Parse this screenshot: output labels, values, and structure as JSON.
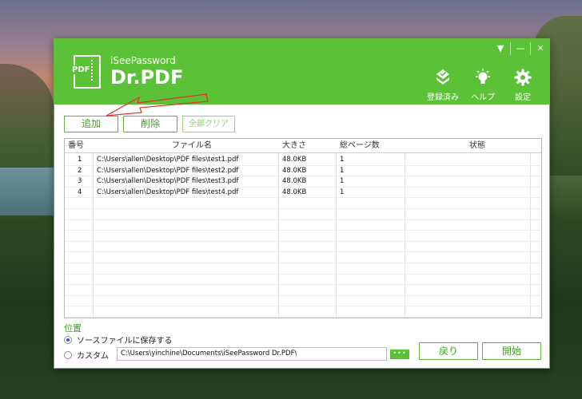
{
  "app": {
    "brand_small": "iSeePassword",
    "brand_big": "Dr.PDF",
    "logo_text": "PDF"
  },
  "window_controls": {
    "menu": "▼",
    "minimize": "—",
    "close": "✕"
  },
  "header_buttons": [
    {
      "label": "登録済み",
      "icon": "registered-icon"
    },
    {
      "label": "ヘルプ",
      "icon": "lightbulb-icon"
    },
    {
      "label": "設定",
      "icon": "gear-icon"
    }
  ],
  "toolbar": {
    "add": "追加",
    "delete": "削除",
    "clear_all": "全部クリア"
  },
  "table": {
    "headers": [
      "番号",
      "ファイル名",
      "大きさ",
      "総ページ数",
      "状態"
    ],
    "rows": [
      {
        "no": "1",
        "file": "C:\\Users\\allen\\Desktop\\PDF files\\test1.pdf",
        "size": "48.0KB",
        "pages": "1",
        "status": ""
      },
      {
        "no": "2",
        "file": "C:\\Users\\allen\\Desktop\\PDF files\\test2.pdf",
        "size": "48.0KB",
        "pages": "1",
        "status": ""
      },
      {
        "no": "3",
        "file": "C:\\Users\\allen\\Desktop\\PDF files\\test3.pdf",
        "size": "48.0KB",
        "pages": "1",
        "status": ""
      },
      {
        "no": "4",
        "file": "C:\\Users\\allen\\Desktop\\PDF files\\test4.pdf",
        "size": "48.0KB",
        "pages": "1",
        "status": ""
      }
    ]
  },
  "output": {
    "label": "位置",
    "option_source": "ソースファイルに保存する",
    "option_custom": "カスタム",
    "custom_path": "C:\\Users\\yinchine\\Documents\\iSeePassword Dr.PDF\\",
    "browse": "•••",
    "selected": "source"
  },
  "actions": {
    "back": "戻り",
    "start": "開始"
  },
  "colors": {
    "accent": "#5bc238",
    "text_green": "#3ea321",
    "annotation": "#e0312b"
  }
}
